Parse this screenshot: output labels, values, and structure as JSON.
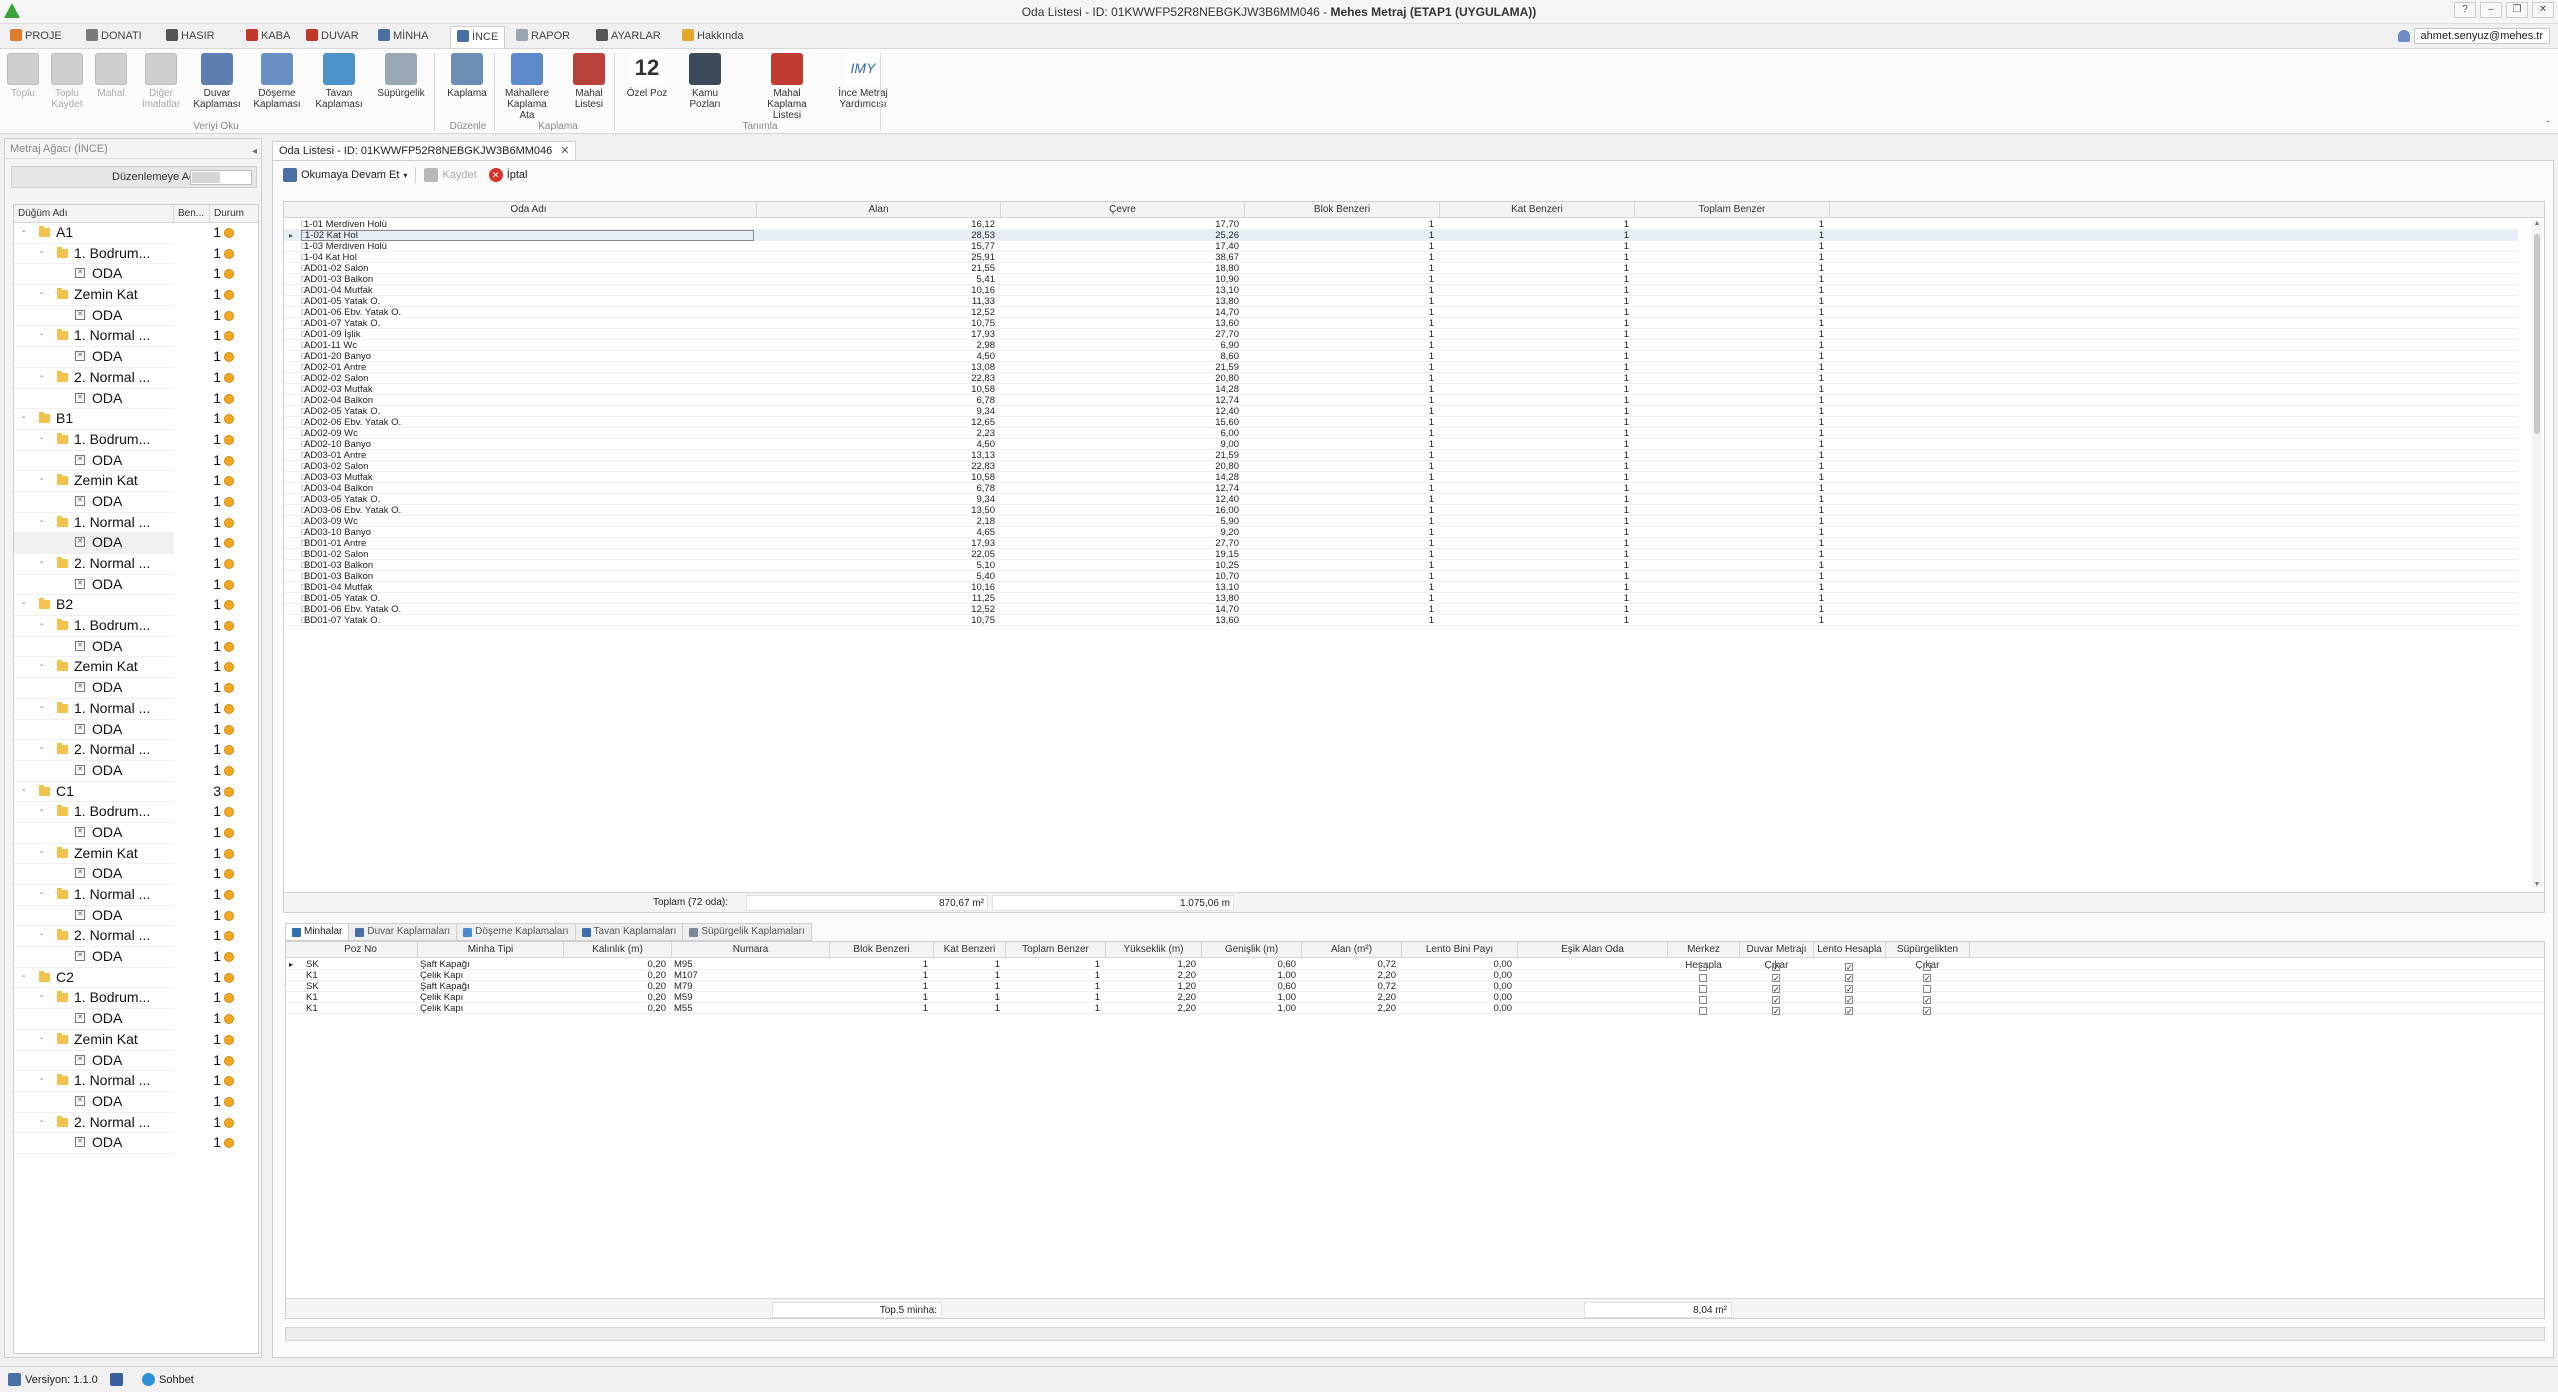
{
  "window": {
    "title_prefix": "Oda Listesi - ID: 01KWWFP52R8NEBGKJW3B6MM046 - ",
    "title_bold": "Mehes Metraj (ETAP1 (UYGULAMA))"
  },
  "menu_tabs": [
    "PROJE",
    "DONATI",
    "HASIR",
    "KABA",
    "DUVAR",
    "MİNHA",
    "İNCE",
    "RAPOR",
    "AYARLAR",
    "Hakkında"
  ],
  "active_tab": "İNCE",
  "user_email": "ahmet.senyuz@mehes.tr",
  "ribbon": {
    "buttons": [
      {
        "label": "Toplu",
        "disabled": true
      },
      {
        "label": "Toplu Kaydet",
        "disabled": true
      },
      {
        "label": "Mahal",
        "disabled": true
      },
      {
        "label": "Diğer İmalatlar",
        "disabled": true
      },
      {
        "label": "Duvar Kaplaması",
        "disabled": false
      },
      {
        "label": "Döşeme Kaplaması",
        "disabled": false
      },
      {
        "label": "Tavan Kaplaması",
        "disabled": false
      },
      {
        "label": "Süpürgelik",
        "disabled": false
      },
      {
        "label": "Kaplama",
        "disabled": false
      },
      {
        "label": "Mahallere Kaplama Ata",
        "disabled": false
      },
      {
        "label": "Mahal Listesi",
        "disabled": false
      },
      {
        "label": "Özel Poz",
        "disabled": false
      },
      {
        "label": "Kamu Pozları",
        "disabled": false
      },
      {
        "label": "Mahal Kaplama Listesi",
        "disabled": false
      },
      {
        "label": "İnce Metraj Yardımcısı",
        "disabled": false
      }
    ],
    "big_number": "12",
    "imy_text": "IMY",
    "groups": [
      "Veriyi Oku",
      "Düzenle",
      "Kaplama",
      "Tanımla"
    ]
  },
  "left_panel": {
    "title": "Metraj Ağacı (İNCE)",
    "edit_label": "Düzenlemeye Aç",
    "columns": [
      "Düğüm Adı",
      "Ben...",
      "Durum"
    ],
    "tree": [
      {
        "level": 0,
        "type": "folder",
        "name": "A1",
        "count": "1"
      },
      {
        "level": 1,
        "type": "folder",
        "name": "1. Bodrum...",
        "count": "1"
      },
      {
        "level": 2,
        "type": "room",
        "name": "ODA",
        "count": "1"
      },
      {
        "level": 1,
        "type": "folder",
        "name": "Zemin Kat",
        "count": "1"
      },
      {
        "level": 2,
        "type": "room",
        "name": "ODA",
        "count": "1"
      },
      {
        "level": 1,
        "type": "folder",
        "name": "1. Normal ...",
        "count": "1"
      },
      {
        "level": 2,
        "type": "room",
        "name": "ODA",
        "count": "1"
      },
      {
        "level": 1,
        "type": "folder",
        "name": "2. Normal ...",
        "count": "1"
      },
      {
        "level": 2,
        "type": "room",
        "name": "ODA",
        "count": "1"
      },
      {
        "level": 0,
        "type": "folder",
        "name": "B1",
        "count": "1"
      },
      {
        "level": 1,
        "type": "folder",
        "name": "1. Bodrum...",
        "count": "1"
      },
      {
        "level": 2,
        "type": "room",
        "name": "ODA",
        "count": "1"
      },
      {
        "level": 1,
        "type": "folder",
        "name": "Zemin Kat",
        "count": "1"
      },
      {
        "level": 2,
        "type": "room",
        "name": "ODA",
        "count": "1"
      },
      {
        "level": 1,
        "type": "folder",
        "name": "1. Normal ...",
        "count": "1"
      },
      {
        "level": 2,
        "type": "room",
        "name": "ODA",
        "count": "1",
        "selected": true
      },
      {
        "level": 1,
        "type": "folder",
        "name": "2. Normal ...",
        "count": "1"
      },
      {
        "level": 2,
        "type": "room",
        "name": "ODA",
        "count": "1"
      },
      {
        "level": 0,
        "type": "folder",
        "name": "B2",
        "count": "1"
      },
      {
        "level": 1,
        "type": "folder",
        "name": "1. Bodrum...",
        "count": "1"
      },
      {
        "level": 2,
        "type": "room",
        "name": "ODA",
        "count": "1"
      },
      {
        "level": 1,
        "type": "folder",
        "name": "Zemin Kat",
        "count": "1"
      },
      {
        "level": 2,
        "type": "room",
        "name": "ODA",
        "count": "1"
      },
      {
        "level": 1,
        "type": "folder",
        "name": "1. Normal ...",
        "count": "1"
      },
      {
        "level": 2,
        "type": "room",
        "name": "ODA",
        "count": "1"
      },
      {
        "level": 1,
        "type": "folder",
        "name": "2. Normal ...",
        "count": "1"
      },
      {
        "level": 2,
        "type": "room",
        "name": "ODA",
        "count": "1"
      },
      {
        "level": 0,
        "type": "folder",
        "name": "C1",
        "count": "3"
      },
      {
        "level": 1,
        "type": "folder",
        "name": "1. Bodrum...",
        "count": "1"
      },
      {
        "level": 2,
        "type": "room",
        "name": "ODA",
        "count": "1"
      },
      {
        "level": 1,
        "type": "folder",
        "name": "Zemin Kat",
        "count": "1"
      },
      {
        "level": 2,
        "type": "room",
        "name": "ODA",
        "count": "1"
      },
      {
        "level": 1,
        "type": "folder",
        "name": "1. Normal ...",
        "count": "1"
      },
      {
        "level": 2,
        "type": "room",
        "name": "ODA",
        "count": "1"
      },
      {
        "level": 1,
        "type": "folder",
        "name": "2. Normal ...",
        "count": "1"
      },
      {
        "level": 2,
        "type": "room",
        "name": "ODA",
        "count": "1"
      },
      {
        "level": 0,
        "type": "folder",
        "name": "C2",
        "count": "1"
      },
      {
        "level": 1,
        "type": "folder",
        "name": "1. Bodrum...",
        "count": "1"
      },
      {
        "level": 2,
        "type": "room",
        "name": "ODA",
        "count": "1"
      },
      {
        "level": 1,
        "type": "folder",
        "name": "Zemin Kat",
        "count": "1"
      },
      {
        "level": 2,
        "type": "room",
        "name": "ODA",
        "count": "1"
      },
      {
        "level": 1,
        "type": "folder",
        "name": "1. Normal ...",
        "count": "1"
      },
      {
        "level": 2,
        "type": "room",
        "name": "ODA",
        "count": "1"
      },
      {
        "level": 1,
        "type": "folder",
        "name": "2. Normal ...",
        "count": "1"
      },
      {
        "level": 2,
        "type": "room",
        "name": "ODA",
        "count": "1"
      }
    ]
  },
  "document_tab": "Oda Listesi - ID: 01KWWFP52R8NEBGKJW3B6MM046",
  "toolbar": {
    "continue_label": "Okumaya Devam Et",
    "save_label": "Kaydet",
    "cancel_label": "İptal"
  },
  "rooms_grid": {
    "columns": [
      "Oda Adı",
      "Alan",
      "Çevre",
      "Blok Benzeri",
      "Kat Benzeri",
      "Toplam Benzer"
    ],
    "rows": [
      [
        "1-01 Merdiven Holü",
        "16,12",
        "17,70",
        "1",
        "1",
        "1"
      ],
      [
        "1-02 Kat Hol",
        "28,53",
        "25,26",
        "1",
        "1",
        "1"
      ],
      [
        "1-03 Merdiven Holü",
        "15,77",
        "17,40",
        "1",
        "1",
        "1"
      ],
      [
        "1-04 Kat Hol",
        "25,91",
        "38,67",
        "1",
        "1",
        "1"
      ],
      [
        "AD01-02 Salon",
        "21,55",
        "18,80",
        "1",
        "1",
        "1"
      ],
      [
        "AD01-03 Balkon",
        "5,41",
        "10,90",
        "1",
        "1",
        "1"
      ],
      [
        "AD01-04 Mutfak",
        "10,16",
        "13,10",
        "1",
        "1",
        "1"
      ],
      [
        "AD01-05 Yatak O.",
        "11,33",
        "13,80",
        "1",
        "1",
        "1"
      ],
      [
        "AD01-06 Ebv. Yatak O.",
        "12,52",
        "14,70",
        "1",
        "1",
        "1"
      ],
      [
        "AD01-07 Yatak O.",
        "10,75",
        "13,60",
        "1",
        "1",
        "1"
      ],
      [
        "AD01-09 İşlik",
        "17,93",
        "27,70",
        "1",
        "1",
        "1"
      ],
      [
        "AD01-11 Wc",
        "2,98",
        "6,90",
        "1",
        "1",
        "1"
      ],
      [
        "AD01-20 Banyo",
        "4,50",
        "8,60",
        "1",
        "1",
        "1"
      ],
      [
        "AD02-01 Antre",
        "13,08",
        "21,59",
        "1",
        "1",
        "1"
      ],
      [
        "AD02-02 Salon",
        "22,83",
        "20,80",
        "1",
        "1",
        "1"
      ],
      [
        "AD02-03 Mutfak",
        "10,58",
        "14,28",
        "1",
        "1",
        "1"
      ],
      [
        "AD02-04 Balkon",
        "6,78",
        "12,74",
        "1",
        "1",
        "1"
      ],
      [
        "AD02-05 Yatak O.",
        "9,34",
        "12,40",
        "1",
        "1",
        "1"
      ],
      [
        "AD02-06 Ebv. Yatak O.",
        "12,65",
        "15,60",
        "1",
        "1",
        "1"
      ],
      [
        "AD02-09 Wc",
        "2,23",
        "6,00",
        "1",
        "1",
        "1"
      ],
      [
        "AD02-10 Banyo",
        "4,50",
        "9,00",
        "1",
        "1",
        "1"
      ],
      [
        "AD03-01 Antre",
        "13,13",
        "21,59",
        "1",
        "1",
        "1"
      ],
      [
        "AD03-02 Salon",
        "22,83",
        "20,80",
        "1",
        "1",
        "1"
      ],
      [
        "AD03-03 Mutfak",
        "10,58",
        "14,28",
        "1",
        "1",
        "1"
      ],
      [
        "AD03-04 Balkon",
        "6,78",
        "12,74",
        "1",
        "1",
        "1"
      ],
      [
        "AD03-05 Yatak O.",
        "9,34",
        "12,40",
        "1",
        "1",
        "1"
      ],
      [
        "AD03-06 Ebv. Yatak O.",
        "13,50",
        "16,00",
        "1",
        "1",
        "1"
      ],
      [
        "AD03-09 Wc",
        "2,18",
        "5,90",
        "1",
        "1",
        "1"
      ],
      [
        "AD03-10 Banyo",
        "4,65",
        "9,20",
        "1",
        "1",
        "1"
      ],
      [
        "BD01-01 Antre",
        "17,93",
        "27,70",
        "1",
        "1",
        "1"
      ],
      [
        "BD01-02 Salon",
        "22,05",
        "19,15",
        "1",
        "1",
        "1"
      ],
      [
        "BD01-03 Balkon",
        "5,10",
        "10,25",
        "1",
        "1",
        "1"
      ],
      [
        "BD01-03 Balkon",
        "5,40",
        "10,70",
        "1",
        "1",
        "1"
      ],
      [
        "BD01-04 Mutfak",
        "10,16",
        "13,10",
        "1",
        "1",
        "1"
      ],
      [
        "BD01-05 Yatak O.",
        "11,25",
        "13,80",
        "1",
        "1",
        "1"
      ],
      [
        "BD01-06 Ebv. Yatak O.",
        "12,52",
        "14,70",
        "1",
        "1",
        "1"
      ],
      [
        "BD01-07 Yatak O.",
        "10,75",
        "13,60",
        "1",
        "1",
        "1"
      ]
    ],
    "selected_row": 1,
    "footer": {
      "label": "Toplam (72 oda):",
      "area_total": "870,67 m²",
      "perimeter_total": "1.075,06 m"
    }
  },
  "bottom_tabs": [
    "Minhalar",
    "Duvar Kaplamaları",
    "Döşeme Kaplamaları",
    "Tavan Kaplamaları",
    "Süpürgelik Kaplamaları"
  ],
  "minha_grid": {
    "columns": [
      "Poz No",
      "Minha Tipi",
      "Kalınlık (m)",
      "Numara",
      "Blok Benzeri",
      "Kat Benzeri",
      "Toplam Benzer",
      "Yükseklik (m)",
      "Genişlik (m)",
      "Alan (m²)",
      "Lento Bini Payı",
      "Eşik Alan Oda",
      "Merkez Hesapla",
      "Duvar Metrajı Çıkar",
      "Lento Hesapla",
      "Süpürgelikten Çıkar"
    ],
    "rows": [
      {
        "poz": "SK",
        "tip": "Şaft Kapağı",
        "kal": "0,20",
        "num": "M95",
        "blok": "1",
        "kat": "1",
        "top": "1",
        "yuk": "1,20",
        "gen": "0,60",
        "alan": "0,72",
        "lento": "0,00",
        "merkez": false,
        "duvar": true,
        "lentoh": true,
        "sup": false
      },
      {
        "poz": "K1",
        "tip": "Çelik Kapı",
        "kal": "0,20",
        "num": "M107",
        "blok": "1",
        "kat": "1",
        "top": "1",
        "yuk": "2,20",
        "gen": "1,00",
        "alan": "2,20",
        "lento": "0,00",
        "merkez": false,
        "duvar": true,
        "lentoh": true,
        "sup": true
      },
      {
        "poz": "SK",
        "tip": "Şaft Kapağı",
        "kal": "0,20",
        "num": "M79",
        "blok": "1",
        "kat": "1",
        "top": "1",
        "yuk": "1,20",
        "gen": "0,60",
        "alan": "0,72",
        "lento": "0,00",
        "merkez": false,
        "duvar": true,
        "lentoh": true,
        "sup": false
      },
      {
        "poz": "K1",
        "tip": "Çelik Kapı",
        "kal": "0,20",
        "num": "M59",
        "blok": "1",
        "kat": "1",
        "top": "1",
        "yuk": "2,20",
        "gen": "1,00",
        "alan": "2,20",
        "lento": "0,00",
        "merkez": false,
        "duvar": true,
        "lentoh": true,
        "sup": true
      },
      {
        "poz": "K1",
        "tip": "Çelik Kapı",
        "kal": "0,20",
        "num": "M55",
        "blok": "1",
        "kat": "1",
        "top": "1",
        "yuk": "2,20",
        "gen": "1,00",
        "alan": "2,20",
        "lento": "0,00",
        "merkez": false,
        "duvar": true,
        "lentoh": true,
        "sup": true
      }
    ],
    "footer": {
      "label": "Top.5 minha:",
      "area_total": "8,04 m²"
    }
  },
  "statusbar": {
    "version": "Versiyon: 1.1.0",
    "chat": "Sohbet"
  },
  "colors": {
    "accent": "#2b6cb0",
    "status_dot": "#f4a722",
    "selection": "#e8eef8"
  }
}
